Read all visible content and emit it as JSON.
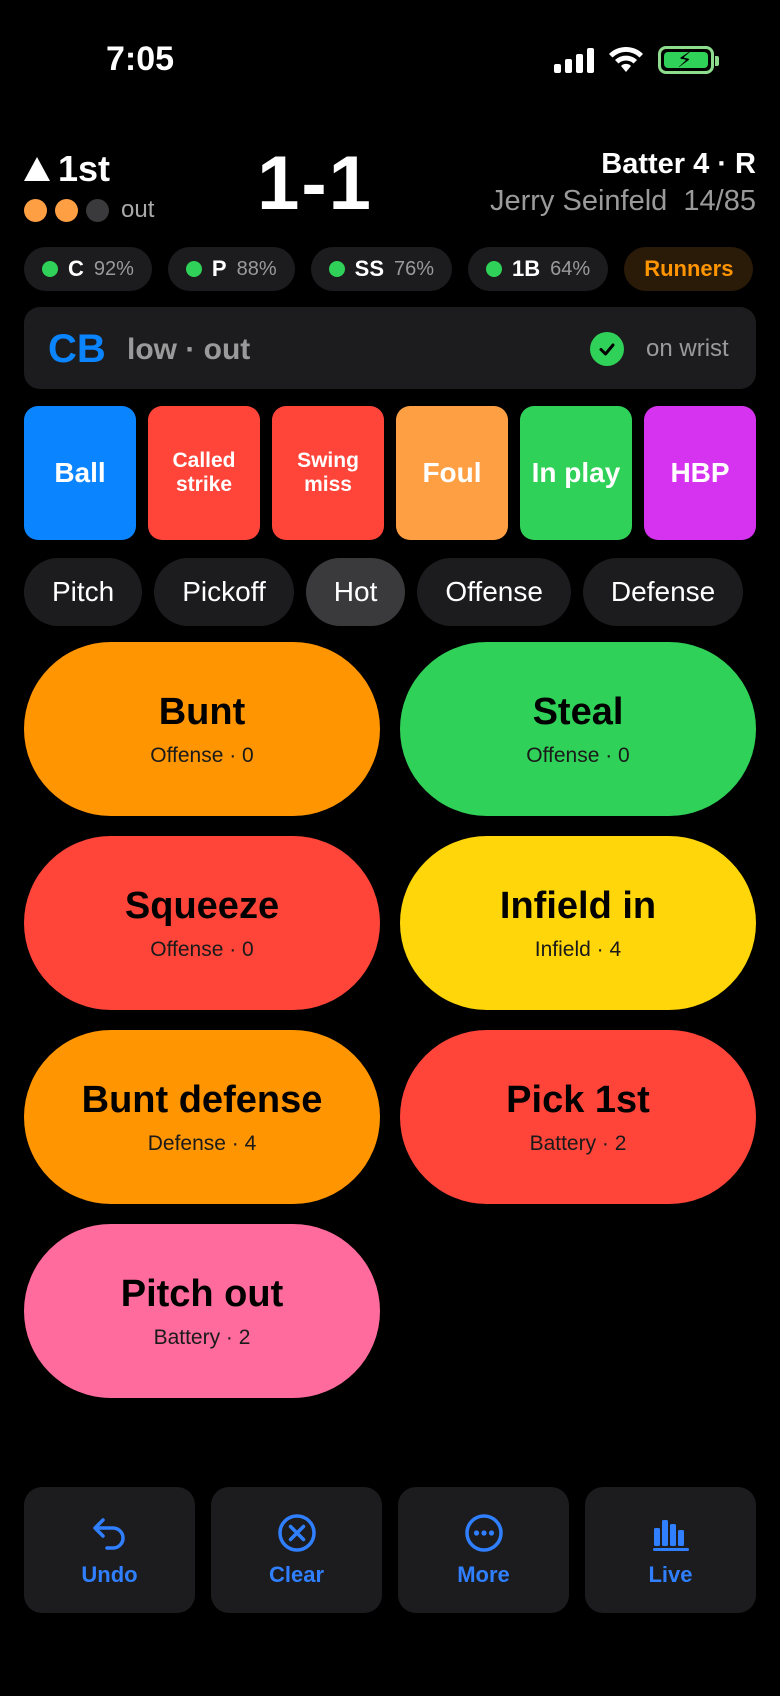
{
  "status_bar": {
    "time": "7:05"
  },
  "header": {
    "inning": "1st",
    "outs_label": "out",
    "outs": [
      {
        "state": "filled",
        "color": "#ff9f43"
      },
      {
        "state": "filled",
        "color": "#ff9f43"
      },
      {
        "state": "empty",
        "color": "#3a3a3c"
      }
    ],
    "score": "1-1",
    "batter": "Batter 4 · R",
    "batter_name": "Jerry Seinfeld",
    "pitch_count": "14/85"
  },
  "fielders": [
    {
      "pos": "C",
      "pct": "92%",
      "status_color": "#30d158"
    },
    {
      "pos": "P",
      "pct": "88%",
      "status_color": "#30d158"
    },
    {
      "pos": "SS",
      "pct": "76%",
      "status_color": "#30d158"
    },
    {
      "pos": "1B",
      "pct": "64%",
      "status_color": "#30d158"
    }
  ],
  "runners_chip": "Runners",
  "sign": {
    "code": "CB",
    "desc": "low · out",
    "status": "on wrist"
  },
  "results": [
    {
      "label": "Ball",
      "color": "#0a84ff",
      "size": "big"
    },
    {
      "label": "Called strike",
      "color": "#ff453a",
      "size": "small"
    },
    {
      "label": "Swing miss",
      "color": "#ff453a",
      "size": "small"
    },
    {
      "label": "Foul",
      "color": "#ff9f43",
      "size": "big"
    },
    {
      "label": "In play",
      "color": "#30d158",
      "size": "big"
    },
    {
      "label": "HBP",
      "color": "#d633f0",
      "size": "big"
    }
  ],
  "tabs": [
    {
      "label": "Pitch",
      "active": false
    },
    {
      "label": "Pickoff",
      "active": false
    },
    {
      "label": "Hot",
      "active": true
    },
    {
      "label": "Offense",
      "active": false
    },
    {
      "label": "Defense",
      "active": false
    }
  ],
  "calls": [
    {
      "name": "Bunt",
      "meta": "Offense · 0",
      "color": "#ff9500"
    },
    {
      "name": "Steal",
      "meta": "Offense · 0",
      "color": "#30d158"
    },
    {
      "name": "Squeeze",
      "meta": "Offense · 0",
      "color": "#ff453a"
    },
    {
      "name": "Infield in",
      "meta": "Infield · 4",
      "color": "#ffd60a"
    },
    {
      "name": "Bunt defense",
      "meta": "Defense · 4",
      "color": "#ff9500"
    },
    {
      "name": "Pick 1st",
      "meta": "Battery · 2",
      "color": "#ff453a"
    },
    {
      "name": "Pitch out",
      "meta": "Battery · 2",
      "color": "#ff6b9d"
    }
  ],
  "toolbar": {
    "undo": "Undo",
    "clear": "Clear",
    "more": "More",
    "live": "Live",
    "accent": "#2f7fff"
  }
}
